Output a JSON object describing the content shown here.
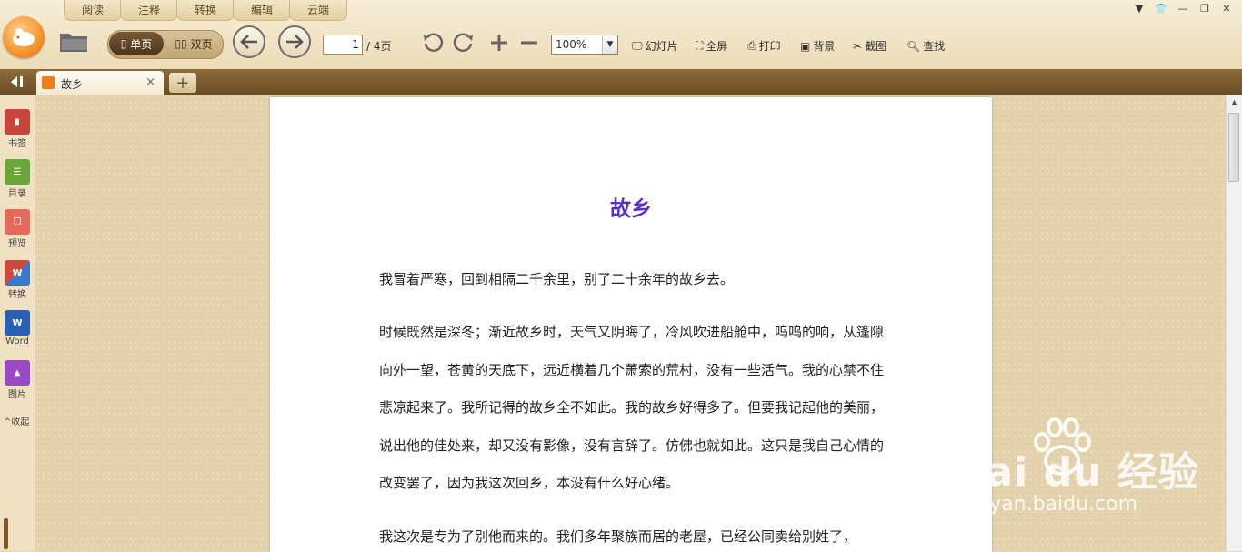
{
  "menu_tabs": [
    "阅读",
    "注释",
    "转换",
    "编辑",
    "云端"
  ],
  "window_controls": [
    "menu-icon",
    "skin-icon",
    "minimize-icon",
    "restore-icon",
    "close-icon"
  ],
  "toolbar": {
    "single_page": "单页",
    "double_page": "双页",
    "current_page": "1",
    "total_pages": "/ 4页",
    "zoom": "100%",
    "slideshow": "幻灯片",
    "fullscreen": "全屏",
    "print": "打印",
    "background": "背景",
    "screenshot": "截图",
    "find": "查找"
  },
  "tab": {
    "name": "故乡",
    "close": "×",
    "add": "+"
  },
  "sidebar": {
    "items": [
      {
        "label": "书签",
        "color": "#c9443a"
      },
      {
        "label": "目录",
        "color": "#6aa53a"
      },
      {
        "label": "预览",
        "color": "#e56a5a"
      },
      {
        "label": "转换",
        "color": "#d04a3a"
      },
      {
        "label": "Word",
        "color": "#2b5fb4"
      },
      {
        "label": "图片",
        "color": "#9b49c8"
      }
    ],
    "collapse": "^收起"
  },
  "document": {
    "title": "故乡",
    "paragraphs": [
      "我冒着严寒，回到相隔二千余里，别了二十余年的故乡去。",
      "时候既然是深冬；渐近故乡时，天气又阴晦了，冷风吹进船舱中，呜呜的响，从篷隙向外一望，苍黄的天底下，远近横着几个萧索的荒村，没有一些活气。我的心禁不住悲凉起来了。我所记得的故乡全不如此。我的故乡好得多了。但要我记起他的美丽，说出他的佳处来，却又没有影像，没有言辞了。仿佛也就如此。这只是我自己心情的改变罢了，因为我这次回乡，本没有什么好心绪。",
      "我这次是专为了别他而来的。我们多年聚族而居的老屋，已经公同卖给别姓了，"
    ]
  },
  "watermark": {
    "text": "Bai du 经验",
    "url": "jingyan.baidu.com"
  }
}
